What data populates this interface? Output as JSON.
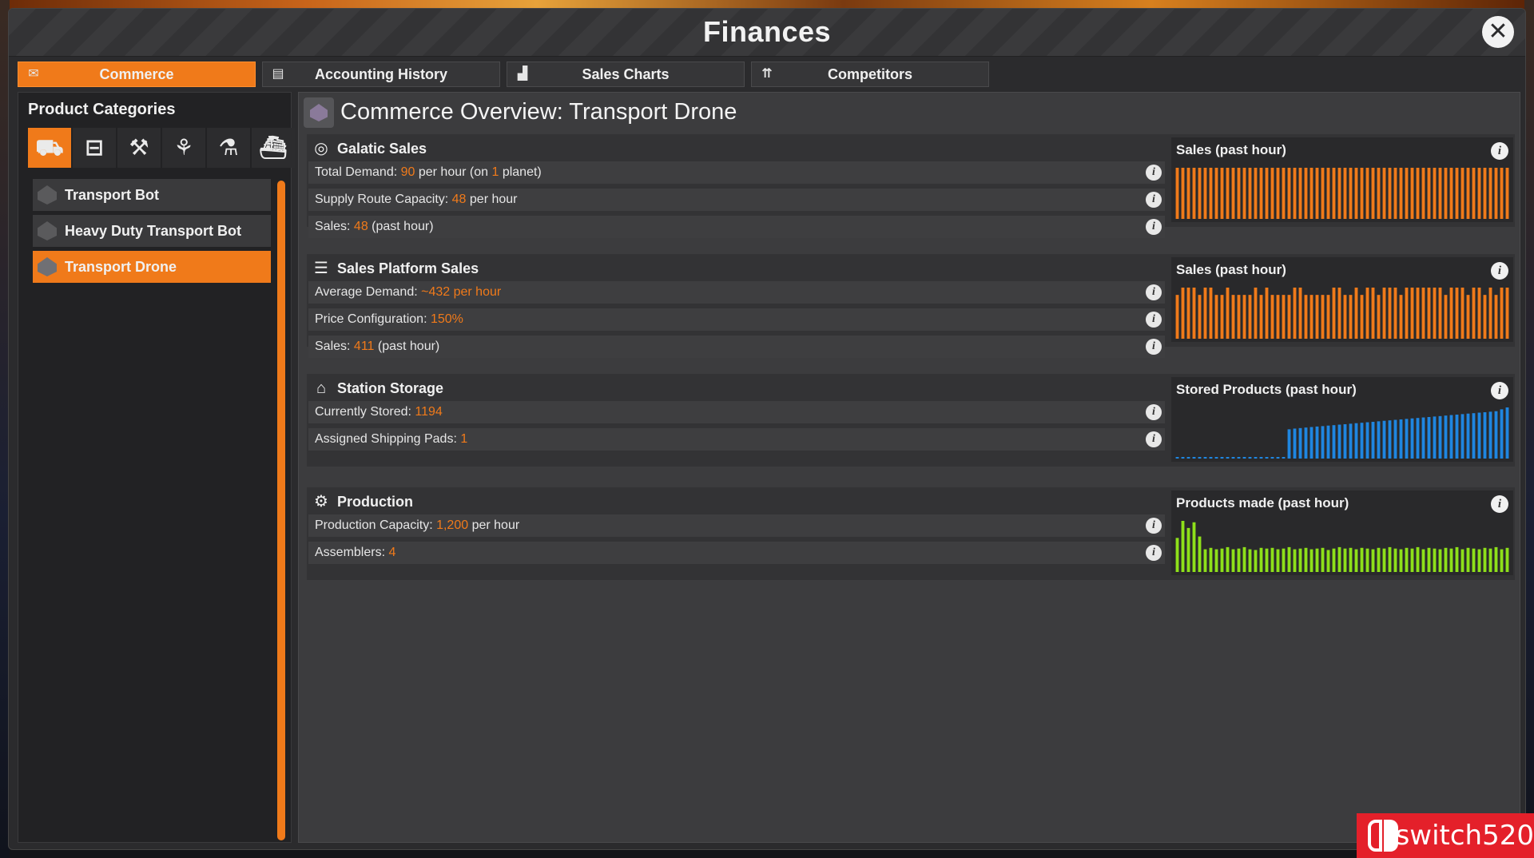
{
  "window": {
    "title": "Finances",
    "close_label": "✕"
  },
  "tabs": [
    {
      "label": "Commerce",
      "icon": "commerce-icon",
      "active": true
    },
    {
      "label": "Accounting History",
      "icon": "ledger-icon",
      "active": false
    },
    {
      "label": "Sales Charts",
      "icon": "bar-chart-icon",
      "active": false
    },
    {
      "label": "Competitors",
      "icon": "ranking-icon",
      "active": false
    }
  ],
  "sidebar": {
    "title": "Product Categories",
    "category_icons": [
      "truck-icon",
      "toolbox-icon",
      "wrench-icon",
      "plant-icon",
      "microscope-icon",
      "tank-icon"
    ],
    "products": [
      {
        "label": "Transport Bot",
        "active": false
      },
      {
        "label": "Heavy Duty Transport Bot",
        "active": false
      },
      {
        "label": "Transport Drone",
        "active": true
      }
    ]
  },
  "overview": {
    "title": "Commerce Overview: Transport Drone"
  },
  "sections": {
    "galactic": {
      "title": "Galatic Sales",
      "rows": [
        {
          "parts": [
            [
              "Total Demand: ",
              false
            ],
            [
              "90",
              true
            ],
            [
              " per hour (on ",
              false
            ],
            [
              "1",
              true
            ],
            [
              " planet)",
              false
            ]
          ]
        },
        {
          "parts": [
            [
              "Supply Route Capacity: ",
              false
            ],
            [
              "48",
              true
            ],
            [
              " per hour",
              false
            ]
          ]
        },
        {
          "parts": [
            [
              "Sales: ",
              false
            ],
            [
              "48",
              true
            ],
            [
              " (past hour)",
              false
            ]
          ]
        }
      ],
      "chart_title": "Sales (past hour)"
    },
    "platform": {
      "title": "Sales Platform Sales",
      "rows": [
        {
          "parts": [
            [
              "Average Demand: ",
              false
            ],
            [
              "~432 per hour",
              true
            ]
          ]
        },
        {
          "parts": [
            [
              "Price Configuration: ",
              false
            ],
            [
              "150%",
              true
            ]
          ]
        },
        {
          "parts": [
            [
              "Sales: ",
              false
            ],
            [
              "411",
              true
            ],
            [
              " (past hour)",
              false
            ]
          ]
        }
      ],
      "chart_title": "Sales (past hour)"
    },
    "storage": {
      "title": "Station Storage",
      "rows": [
        {
          "parts": [
            [
              "Currently Stored: ",
              false
            ],
            [
              "1194",
              true
            ]
          ]
        },
        {
          "parts": [
            [
              "Assigned Shipping Pads: ",
              false
            ],
            [
              "1",
              true
            ]
          ]
        }
      ],
      "chart_title": "Stored Products (past hour)"
    },
    "production": {
      "title": "Production",
      "rows": [
        {
          "parts": [
            [
              "Production Capacity: ",
              false
            ],
            [
              "1,200",
              true
            ],
            [
              " per hour",
              false
            ]
          ]
        },
        {
          "parts": [
            [
              "Assemblers: ",
              false
            ],
            [
              "4",
              true
            ]
          ]
        }
      ],
      "chart_title": "Products made (past hour)"
    }
  },
  "colors": {
    "accent": "#f07a1a",
    "sales_bar": "#f07a1a",
    "storage_bar": "#1f86e0",
    "production_bar": "#8ee01a"
  },
  "chart_data": [
    {
      "type": "bar",
      "title": "Sales (past hour)",
      "series": [
        {
          "values": [
            1,
            1,
            1,
            1,
            1,
            1,
            1,
            1,
            1,
            1,
            1,
            1,
            1,
            1,
            1,
            1,
            1,
            1,
            1,
            1,
            1,
            1,
            1,
            1,
            1,
            1,
            1,
            1,
            1,
            1,
            1,
            1,
            1,
            1,
            1,
            1,
            1,
            1,
            1,
            1,
            1,
            1,
            1,
            1,
            1,
            1,
            1,
            1,
            1,
            1,
            1,
            1,
            1,
            1,
            1,
            1,
            1,
            1,
            1,
            1
          ]
        }
      ],
      "ylim": [
        0,
        1
      ]
    },
    {
      "type": "bar",
      "title": "Sales (past hour)",
      "series": [
        {
          "values": [
            6,
            7,
            7,
            7,
            6,
            7,
            7,
            6,
            6,
            7,
            6,
            6,
            6,
            6,
            7,
            6,
            7,
            6,
            6,
            6,
            6,
            7,
            7,
            6,
            6,
            6,
            6,
            6,
            7,
            7,
            6,
            6,
            7,
            6,
            7,
            7,
            6,
            7,
            7,
            7,
            6,
            7,
            7,
            7,
            7,
            7,
            7,
            7,
            6,
            7,
            7,
            7,
            6,
            7,
            7,
            6,
            7,
            6,
            7,
            7
          ]
        }
      ],
      "ylim": [
        0,
        7
      ]
    },
    {
      "type": "bar",
      "title": "Stored Products (past hour)",
      "series": [
        {
          "values": [
            0,
            0,
            0,
            0,
            0,
            0,
            0,
            0,
            0,
            0,
            0,
            0,
            0,
            0,
            0,
            0,
            0,
            0,
            0,
            0,
            683,
            700,
            712,
            724,
            736,
            748,
            758,
            770,
            780,
            792,
            802,
            814,
            826,
            836,
            848,
            858,
            870,
            882,
            892,
            904,
            914,
            926,
            938,
            948,
            960,
            970,
            982,
            992,
            1004,
            1016,
            1026,
            1038,
            1050,
            1060,
            1072,
            1082,
            1094,
            1106,
            1150,
            1194
          ]
        }
      ],
      "ylim": [
        0,
        1194
      ]
    },
    {
      "type": "bar",
      "title": "Products made (past hour)",
      "series": [
        {
          "values": [
            0,
            0,
            0,
            0,
            0,
            0,
            0,
            0,
            0,
            0,
            0,
            0,
            0,
            0,
            0,
            0,
            0,
            0,
            0,
            0,
            0,
            0,
            0,
            0,
            0,
            0,
            0,
            0,
            0,
            0,
            0,
            0,
            0,
            0,
            0,
            0,
            0,
            0,
            0,
            0,
            0,
            0,
            0,
            0,
            0,
            0,
            0,
            0,
            0,
            0,
            0,
            0,
            0,
            0,
            0,
            0,
            0,
            0,
            0,
            0
          ]
        },
        {
          "values": [
            48,
            72,
            62,
            70,
            50,
            32,
            34,
            32,
            33,
            35,
            32,
            33,
            35,
            32,
            31,
            34,
            33,
            34,
            32,
            33,
            35,
            32,
            33,
            34,
            32,
            33,
            34,
            31,
            33,
            35,
            33,
            34,
            32,
            34,
            33,
            32,
            34,
            33,
            35,
            33,
            32,
            34,
            33,
            35,
            32,
            34,
            33,
            32,
            34,
            33,
            35,
            32,
            34,
            33,
            32,
            34,
            33,
            35,
            32,
            34
          ]
        }
      ],
      "ylim": [
        0,
        72
      ]
    }
  ],
  "watermark": {
    "text": "switch520"
  }
}
